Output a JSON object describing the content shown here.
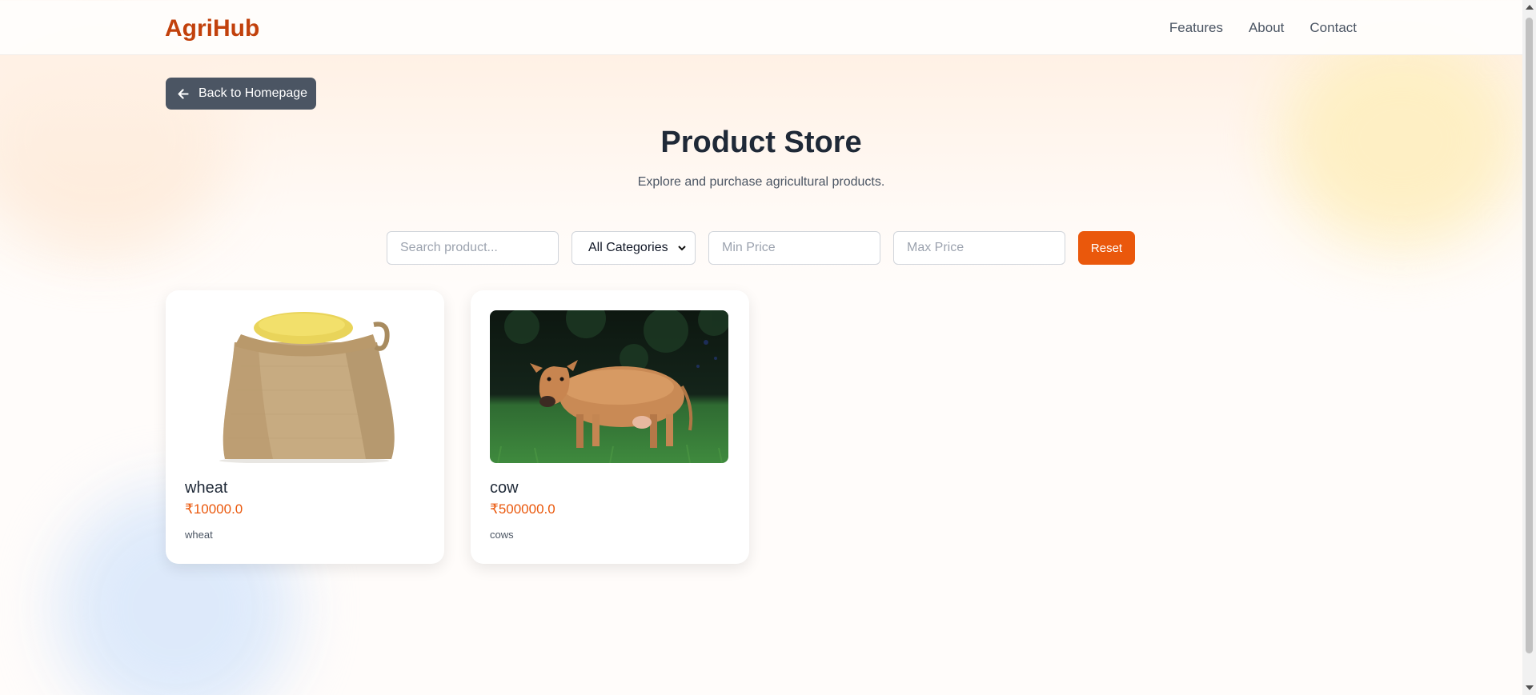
{
  "brand": {
    "name": "AgriHub",
    "color": "#c2410c"
  },
  "nav": [
    "Features",
    "About",
    "Contact"
  ],
  "back_button": {
    "label": "Back to Homepage",
    "icon": "arrow-left-icon"
  },
  "header": {
    "title": "Product Store",
    "subtitle": "Explore and purchase agricultural products."
  },
  "filters": {
    "search_placeholder": "Search product...",
    "category_selected": "All Categories",
    "min_price_placeholder": "Min Price",
    "max_price_placeholder": "Max Price",
    "reset_label": "Reset"
  },
  "products": [
    {
      "name": "wheat",
      "price": "₹10000.0",
      "category": "wheat",
      "image": "sack-of-grain-image"
    },
    {
      "name": "cow",
      "price": "₹500000.0",
      "category": "cows",
      "image": "cow-photo-image"
    }
  ],
  "colors": {
    "accent": "#ea580c",
    "back_button": "#4b5563"
  }
}
